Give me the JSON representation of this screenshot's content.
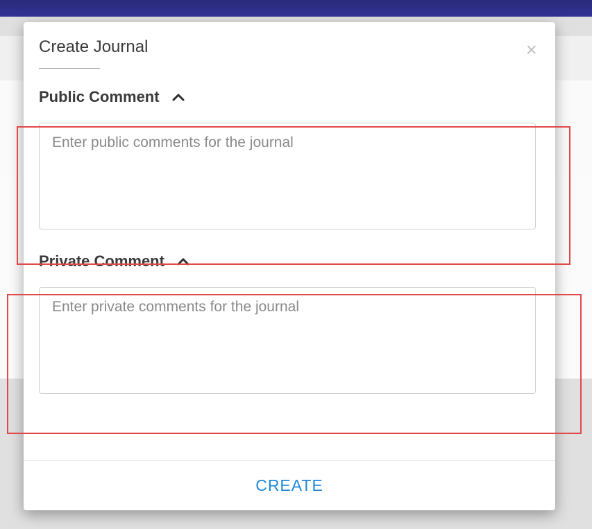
{
  "modal": {
    "title": "Create Journal",
    "close_aria": "Close"
  },
  "sections": {
    "public": {
      "label": "Public Comment",
      "placeholder": "Enter public comments for the journal"
    },
    "private": {
      "label": "Private Comment",
      "placeholder": "Enter private comments for the journal"
    }
  },
  "footer": {
    "create_label": "CREATE"
  }
}
